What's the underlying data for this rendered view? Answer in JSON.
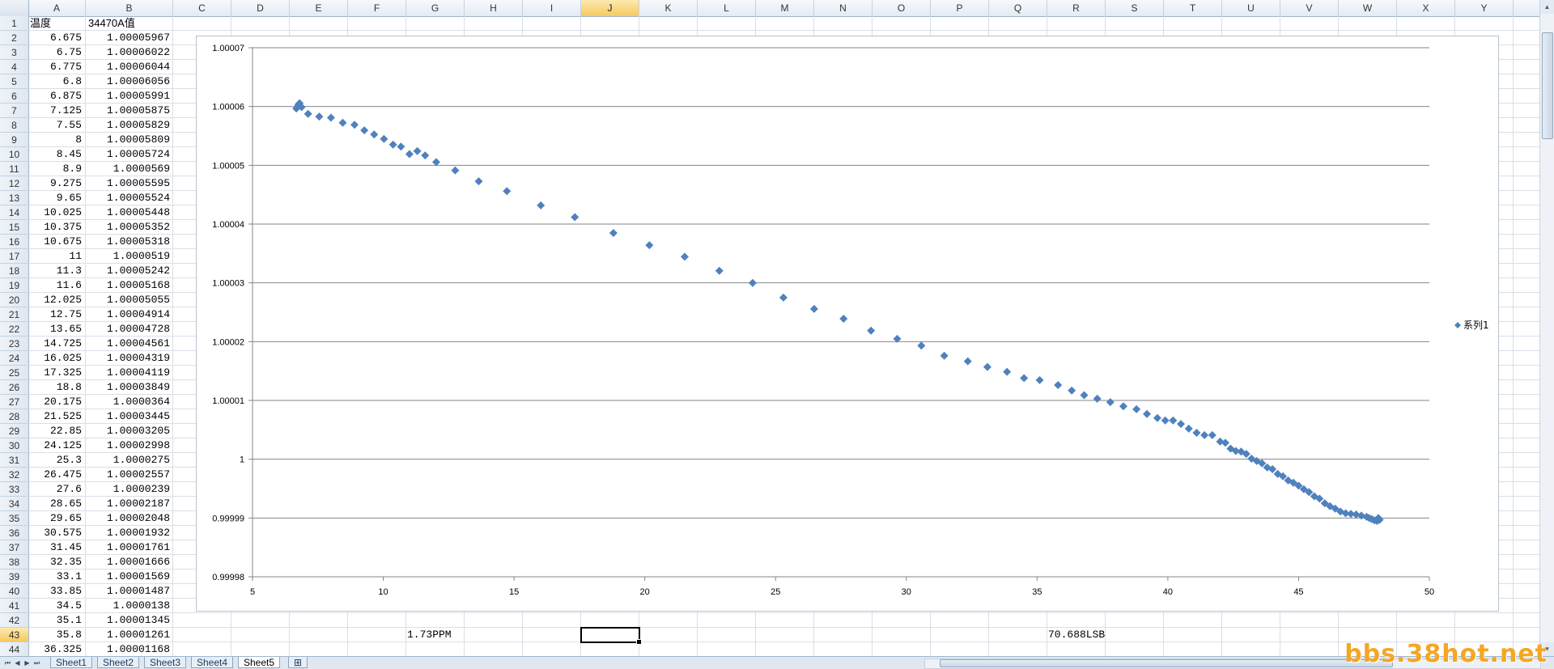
{
  "columns": [
    "A",
    "B",
    "C",
    "D",
    "E",
    "F",
    "G",
    "H",
    "I",
    "J",
    "K",
    "L",
    "M",
    "N",
    "O",
    "P",
    "Q",
    "R",
    "S",
    "T",
    "U",
    "V",
    "W",
    "X",
    "Y"
  ],
  "selected_column": "J",
  "selected_row": 43,
  "sheet": {
    "header_a": "温度",
    "header_b": "34470A值",
    "rows": [
      [
        "6.675",
        "1.00005967"
      ],
      [
        "6.75",
        "1.00006022"
      ],
      [
        "6.775",
        "1.00006044"
      ],
      [
        "6.8",
        "1.00006056"
      ],
      [
        "6.875",
        "1.00005991"
      ],
      [
        "7.125",
        "1.00005875"
      ],
      [
        "7.55",
        "1.00005829"
      ],
      [
        "8",
        "1.00005809"
      ],
      [
        "8.45",
        "1.00005724"
      ],
      [
        "8.9",
        "1.0000569"
      ],
      [
        "9.275",
        "1.00005595"
      ],
      [
        "9.65",
        "1.00005524"
      ],
      [
        "10.025",
        "1.00005448"
      ],
      [
        "10.375",
        "1.00005352"
      ],
      [
        "10.675",
        "1.00005318"
      ],
      [
        "11",
        "1.0000519"
      ],
      [
        "11.3",
        "1.00005242"
      ],
      [
        "11.6",
        "1.00005168"
      ],
      [
        "12.025",
        "1.00005055"
      ],
      [
        "12.75",
        "1.00004914"
      ],
      [
        "13.65",
        "1.00004728"
      ],
      [
        "14.725",
        "1.00004561"
      ],
      [
        "16.025",
        "1.00004319"
      ],
      [
        "17.325",
        "1.00004119"
      ],
      [
        "18.8",
        "1.00003849"
      ],
      [
        "20.175",
        "1.0000364"
      ],
      [
        "21.525",
        "1.00003445"
      ],
      [
        "22.85",
        "1.00003205"
      ],
      [
        "24.125",
        "1.00002998"
      ],
      [
        "25.3",
        "1.0000275"
      ],
      [
        "26.475",
        "1.00002557"
      ],
      [
        "27.6",
        "1.0000239"
      ],
      [
        "28.65",
        "1.00002187"
      ],
      [
        "29.65",
        "1.00002048"
      ],
      [
        "30.575",
        "1.00001932"
      ],
      [
        "31.45",
        "1.00001761"
      ],
      [
        "32.35",
        "1.00001666"
      ],
      [
        "33.1",
        "1.00001569"
      ],
      [
        "33.85",
        "1.00001487"
      ],
      [
        "34.5",
        "1.0000138"
      ],
      [
        "35.1",
        "1.00001345"
      ],
      [
        "35.8",
        "1.00001261"
      ],
      [
        "36.325",
        "1.00001168"
      ]
    ],
    "g43": "1.73PPM",
    "r43": "70.688LSB"
  },
  "chart_data": {
    "type": "scatter",
    "xlim": [
      5,
      50
    ],
    "ylim": [
      0.99998,
      1.00007
    ],
    "x_ticks": [
      "5",
      "10",
      "15",
      "20",
      "25",
      "30",
      "35",
      "40",
      "45",
      "50"
    ],
    "y_ticks": [
      "0.99998",
      "0.99999",
      "1",
      "1.00001",
      "1.00002",
      "1.00003",
      "1.00004",
      "1.00005",
      "1.00006",
      "1.00007"
    ],
    "grid": true,
    "legend": "right",
    "marker_color": "#4f81bd",
    "series": [
      {
        "name": "系列1",
        "x": [
          6.675,
          6.75,
          6.775,
          6.8,
          6.875,
          7.125,
          7.55,
          8,
          8.45,
          8.9,
          9.275,
          9.65,
          10.025,
          10.375,
          10.675,
          11,
          11.3,
          11.6,
          12.025,
          12.75,
          13.65,
          14.725,
          16.025,
          17.325,
          18.8,
          20.175,
          21.525,
          22.85,
          24.125,
          25.3,
          26.475,
          27.6,
          28.65,
          29.65,
          30.575,
          31.45,
          32.35,
          33.1,
          33.85,
          34.5,
          35.1,
          35.8,
          36.325,
          36.8,
          37.3,
          37.8,
          38.3,
          38.8,
          39.2,
          39.6,
          39.9,
          40.2,
          40.5,
          40.8,
          41.1,
          41.4,
          41.7,
          42.0,
          42.2,
          42.4,
          42.6,
          42.8,
          43.0,
          43.2,
          43.4,
          43.6,
          43.8,
          44.0,
          44.2,
          44.4,
          44.6,
          44.8,
          45.0,
          45.2,
          45.4,
          45.6,
          45.8,
          46.0,
          46.2,
          46.4,
          46.6,
          46.8,
          47.0,
          47.2,
          47.4,
          47.6,
          47.7,
          47.8,
          47.9,
          48.0,
          48.05,
          48.1
        ],
        "y": [
          1.00005967,
          1.00006022,
          1.00006044,
          1.00006056,
          1.00005991,
          1.00005875,
          1.00005829,
          1.00005809,
          1.00005724,
          1.0000569,
          1.00005595,
          1.00005524,
          1.00005448,
          1.00005352,
          1.00005318,
          1.0000519,
          1.00005242,
          1.00005168,
          1.00005055,
          1.00004914,
          1.00004728,
          1.00004561,
          1.00004319,
          1.00004119,
          1.00003849,
          1.0000364,
          1.00003445,
          1.00003205,
          1.00002998,
          1.0000275,
          1.00002557,
          1.0000239,
          1.00002187,
          1.00002048,
          1.00001932,
          1.00001761,
          1.00001666,
          1.00001569,
          1.00001487,
          1.0000138,
          1.00001345,
          1.00001261,
          1.00001168,
          1.0000109,
          1.0000103,
          1.0000097,
          1.000009,
          1.0000085,
          1.0000077,
          1.000007,
          1.0000066,
          1.0000066,
          1.000006,
          1.0000052,
          1.0000045,
          1.0000041,
          1.0000041,
          1.000003,
          1.0000028,
          1.0000018,
          1.0000014,
          1.0000013,
          1.0000009,
          1.0000001,
          0.9999997,
          0.9999993,
          0.9999986,
          0.9999983,
          0.9999975,
          0.9999971,
          0.9999964,
          0.999996,
          0.9999955,
          0.9999949,
          0.9999944,
          0.9999937,
          0.9999933,
          0.9999925,
          0.999992,
          0.9999916,
          0.9999911,
          0.9999908,
          0.9999907,
          0.9999906,
          0.9999904,
          0.9999902,
          0.99999,
          0.9999898,
          0.9999896,
          0.9999895,
          0.99999,
          0.9999897
        ]
      }
    ]
  },
  "sheet_tabs": [
    "Sheet1",
    "Sheet2",
    "Sheet3",
    "Sheet4",
    "Sheet5"
  ],
  "active_tab": "Sheet5",
  "watermark": "bbs.38hot.net"
}
